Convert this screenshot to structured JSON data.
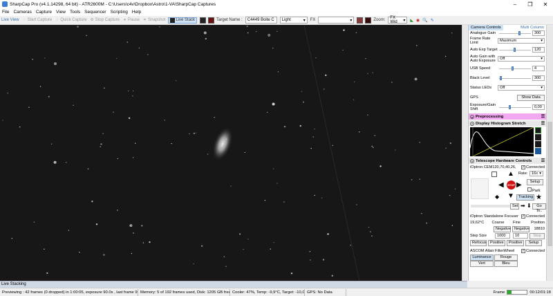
{
  "window": {
    "title": "SharpCap Pro (v4.1.14298, 64 bit) - ATR2600M - C:\\Users\\c4v\\Dropbox\\Astro\\1-VA\\SharpCap Captures",
    "minimize": "–",
    "maximize": "❐",
    "close": "✕"
  },
  "menu": [
    "File",
    "Cameras",
    "Capture",
    "View",
    "Tools",
    "Sequencer",
    "Scripting",
    "Help"
  ],
  "toolbar": {
    "live_view": "Live View",
    "start_capture": "Start Capture",
    "quick_capture": "Quick Capture",
    "stop_capture": "Stop Capture",
    "pause": "Pause",
    "snapshot": "Snapshot",
    "live_stack": "Live Stack",
    "target_name_label": "Target Name :",
    "target_name_value": "C4449 Boite C",
    "frame_type": "Light",
    "fx_label": "FX",
    "zoom_label": "Zoom:",
    "zoom_value": "FX Wid"
  },
  "viewer": {
    "live_stacking_label": "Live Stacking"
  },
  "statusbar": {
    "previewing": "Previewing : 42 frames (0 dropped) in 1:00:05, exposure 90.0s , last frame 90.0s",
    "memory": "Memory: 5 of 192 frames used, Disk: 1205 GB free",
    "cooler": "Cooler: 47%, Temp: -9,9°C, Target: -10,0°C",
    "gps": "GPS: No Data",
    "frame_label": "Frame",
    "time": "00:12/01:18"
  },
  "panel": {
    "tab_camera": "Camera Controls",
    "tab_multi": "Multi Column",
    "analogue_gain_label": "Analogue Gain",
    "analogue_gain_value": "300",
    "frame_rate_label": "Frame Rate Limit",
    "frame_rate_value": "Maximum",
    "auto_exp_label": "Auto Exp Target",
    "auto_exp_value": "120",
    "auto_gain_label": "Auto Gain with Auto Exposure",
    "auto_gain_value": "Off",
    "usb_speed_label": "USB Speed",
    "usb_speed_value": "4",
    "black_level_label": "Black Level",
    "black_level_value": "300",
    "status_leds_label": "Status LEDs",
    "status_leds_value": "Off",
    "gps_label": "GPS",
    "show_data": "Show Data",
    "exp_gain_shift_label": "Exposure/Gain Shift",
    "exp_gain_shift_value": "0,00",
    "preprocessing": "Preprocessing",
    "histogram": "Display Histogram Stretch",
    "telescope": "Telescope Hardware Controls",
    "mount_name": "iOptron CEM120,70,40,26, ",
    "connected": "Connected",
    "rate_label": "Rate:",
    "rate_value": "16x",
    "setup": "Setup",
    "park": "Park",
    "tracking": "Tracking",
    "stop": "STOP",
    "set": "Set",
    "goto": "Go To..",
    "focuser_name": "iOptron Standalone Focuser",
    "focus_temp": "19,62°C",
    "coarse": "Coarse",
    "fine": "Fine",
    "position": "Position",
    "negative": "Negative",
    "position_value": "18810",
    "step_size_label": "Step Size",
    "step_size_value": "1000",
    "fine_step_value": "10",
    "stop_btn": "Stop",
    "refocus": "Refocus",
    "positive": "Positive",
    "filter_name": "ASCOM Altair FilterWheel",
    "filters": [
      "Luminance",
      "Rouge",
      "Vert",
      "Bleu"
    ]
  }
}
